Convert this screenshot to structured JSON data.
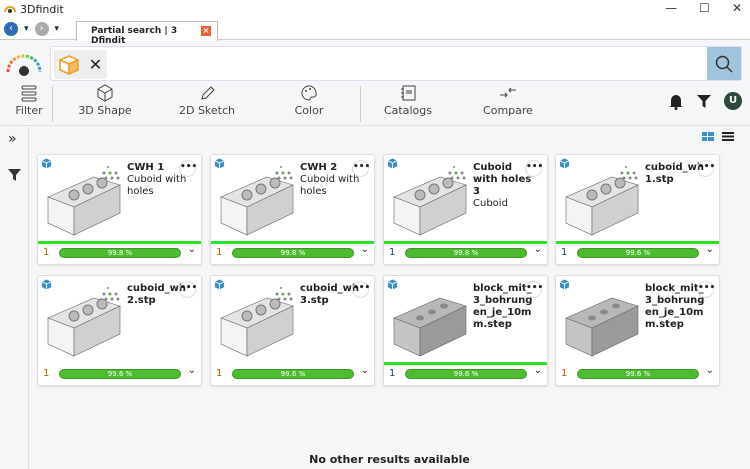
{
  "window": {
    "title": "3Dfindit",
    "minimize": "—",
    "maximize": "☐",
    "close": "✕"
  },
  "tab": {
    "label": "Partial search | 3 Dfindit"
  },
  "toolbar": {
    "filter": "Filter",
    "shape3d": "3D Shape",
    "sketch2d": "2D Sketch",
    "color": "Color",
    "catalogs": "Catalogs",
    "compare": "Compare",
    "avatar": "U"
  },
  "colors": {
    "accent": "#3a8fc7",
    "match_bar": "#4cbb30",
    "search_btn": "#9fc4dc"
  },
  "results": [
    {
      "name": "CWH 1",
      "sub": "Cuboid with holes",
      "rank": "1",
      "match": "99.8 %",
      "ranked": true,
      "green": true,
      "detail": true
    },
    {
      "name": "CWH 2",
      "sub": "Cuboid with holes",
      "rank": "1",
      "match": "99.8 %",
      "ranked": true,
      "green": true,
      "detail": true
    },
    {
      "name": "Cuboid with holes 3",
      "sub": "Cuboid",
      "rank": "1",
      "match": "99.8 %",
      "ranked": false,
      "green": true,
      "detail": true
    },
    {
      "name": "cuboid_wh 1.stp",
      "sub": "",
      "rank": "1",
      "match": "99.6 %",
      "ranked": false,
      "green": true,
      "detail": true
    },
    {
      "name": "cuboid_wh 2.stp",
      "sub": "",
      "rank": "1",
      "match": "99.6 %",
      "ranked": true,
      "green": false,
      "detail": true
    },
    {
      "name": "cuboid_wh 3.stp",
      "sub": "",
      "rank": "1",
      "match": "99.6 %",
      "ranked": true,
      "green": false,
      "detail": true
    },
    {
      "name": "block_mit_ 3_bohrung en_je_10m m.step",
      "sub": "",
      "rank": "1",
      "match": "99.6 %",
      "ranked": false,
      "green": true,
      "detail": false
    },
    {
      "name": "block_mit_ 3_bohrung en_je_10m m.step",
      "sub": "",
      "rank": "1",
      "match": "99.6 %",
      "ranked": true,
      "green": false,
      "detail": false
    }
  ],
  "footer": "No other results available"
}
